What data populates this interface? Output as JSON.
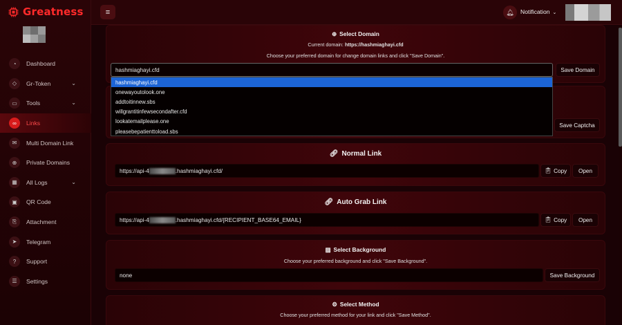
{
  "brand": {
    "name": "Greatness"
  },
  "topbar": {
    "notification_label": "Notification"
  },
  "nav": [
    {
      "label": "Dashboard",
      "icon": "dashboard-icon"
    },
    {
      "label": "Gr-Token",
      "icon": "diamond-icon",
      "chevron": true
    },
    {
      "label": "Tools",
      "icon": "laptop-icon",
      "chevron": true
    },
    {
      "label": "Links",
      "icon": "link-icon",
      "active": true
    },
    {
      "label": "Multi Domain Link",
      "icon": "mail-icon"
    },
    {
      "label": "Private Domains",
      "icon": "globe-icon"
    },
    {
      "label": "All Logs",
      "icon": "grid-icon",
      "chevron": true
    },
    {
      "label": "QR Code",
      "icon": "qr-icon"
    },
    {
      "label": "Attachment",
      "icon": "paperclip-icon"
    },
    {
      "label": "Telegram",
      "icon": "telegram-icon"
    },
    {
      "label": "Support",
      "icon": "question-icon"
    },
    {
      "label": "Settings",
      "icon": "gear-icon"
    }
  ],
  "select_domain": {
    "title": "Select Domain",
    "current_prefix": "Current domain:",
    "current_value": "https://hashmiaghayi.cfd",
    "instruction": "Choose your preferred domain for change domain links and click \"Save Domain\".",
    "selected": "hashmiaghayi.cfd",
    "save_label": "Save Domain",
    "options": [
      "hashmiaghayi.cfd",
      "onewayoutolook.one",
      "addtoitinnew.sbs",
      "willgrantitinfewsecondafter.cfd",
      "lookatemailplease.one",
      "pleasebepatienttoload.sbs"
    ]
  },
  "captcha": {
    "save_label": "Save Captcha"
  },
  "normal_link": {
    "title": "Normal Link",
    "prefix": "https://api-4",
    "suffix": ".hashmiaghayi.cfd/",
    "copy_label": "Copy",
    "open_label": "Open"
  },
  "auto_grab": {
    "title": "Auto Grab Link",
    "prefix": "https://api-4",
    "suffix": ".hashmiaghayi.cfd/{RECIPIENT_BASE64_EMAIL}",
    "copy_label": "Copy",
    "open_label": "Open"
  },
  "background": {
    "title": "Select Background",
    "instruction": "Choose your preferred background and click \"Save Background\".",
    "value": "none",
    "save_label": "Save Background"
  },
  "method": {
    "title": "Select Method",
    "instruction": "Choose your preferred method for your link and click \"Save Method\"."
  },
  "colors": {
    "accent": "#ff2a2a",
    "selected_option": "#1c64d6"
  }
}
